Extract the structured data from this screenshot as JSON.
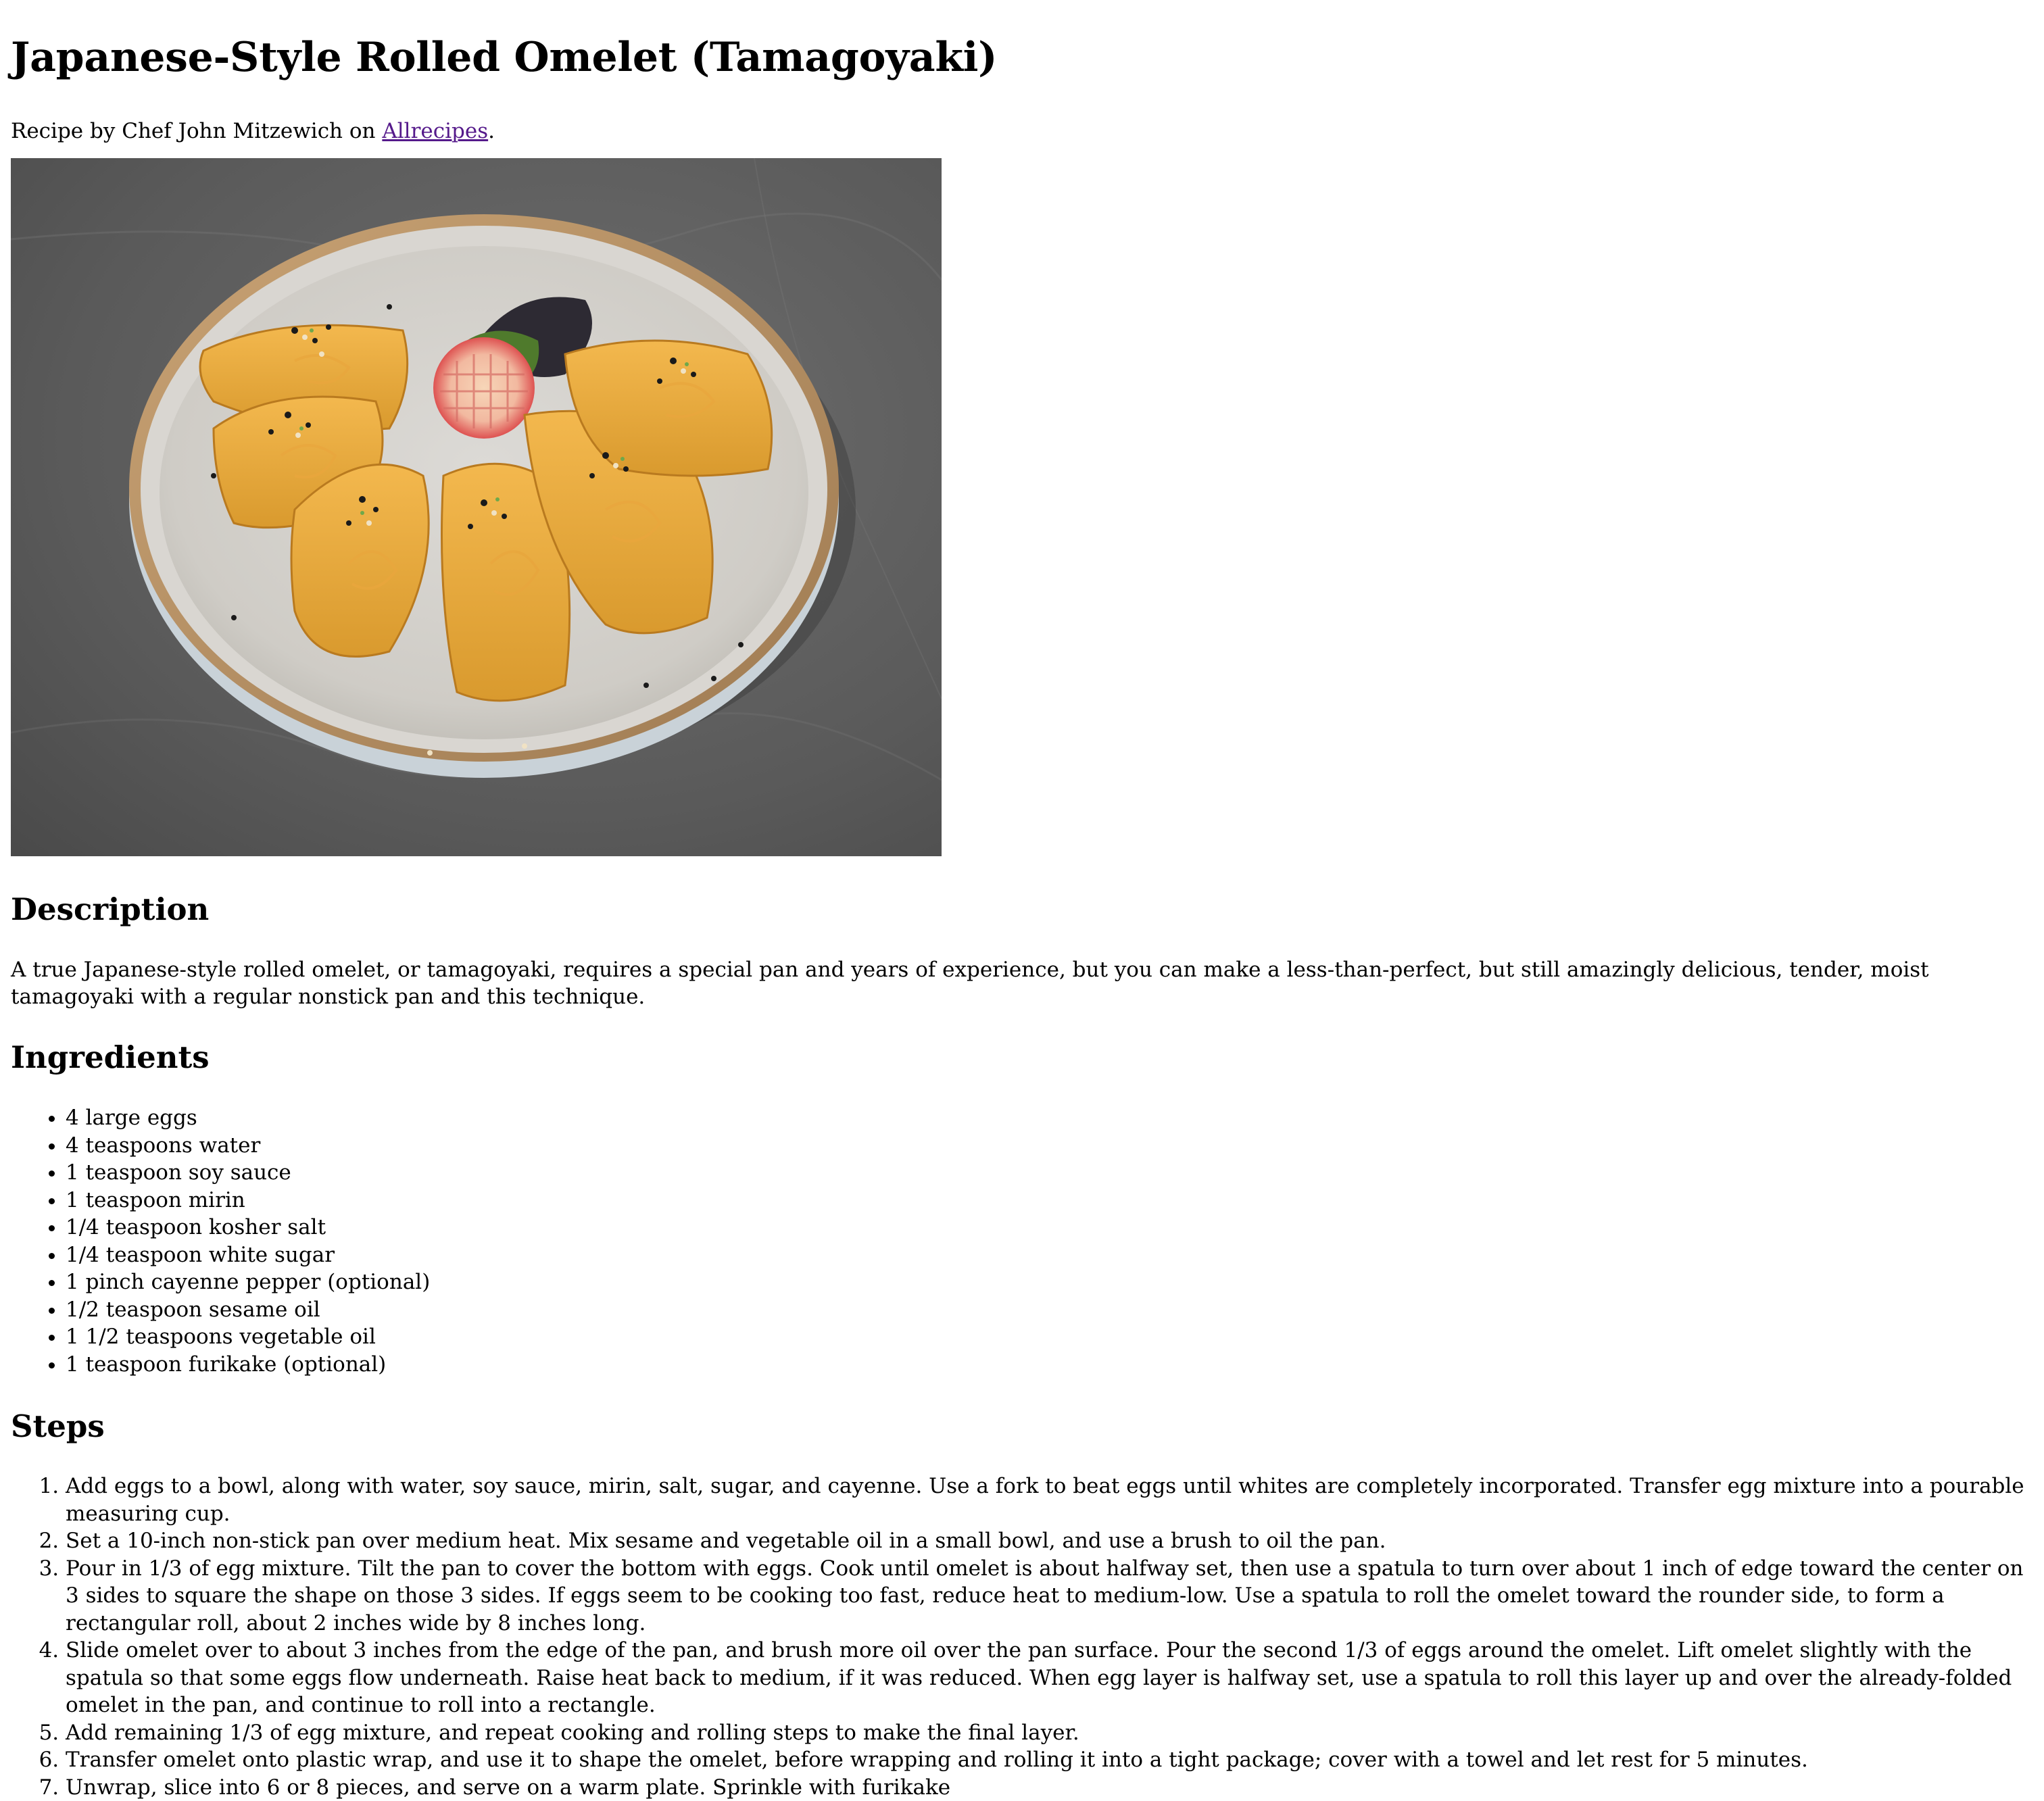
{
  "recipe": {
    "title": "Japanese-Style Rolled Omelet (Tamagoyaki)",
    "byline_prefix": "Recipe by Chef John Mitzewich on ",
    "source_link": "Allrecipes",
    "byline_suffix": "."
  },
  "image": {
    "description_icon": "photo-tamagoyaki-plate"
  },
  "description": {
    "heading": "Description",
    "text": "A true Japanese-style rolled omelet, or tamagoyaki, requires a special pan and years of experience, but you can make a less-than-perfect, but still amazingly delicious, tender, moist tamagoyaki with a regular nonstick pan and this technique."
  },
  "ingredients": {
    "heading": "Ingredients",
    "items": [
      "4 large eggs",
      "4 teaspoons water",
      "1 teaspoon soy sauce",
      "1 teaspoon mirin",
      "1/4 teaspoon kosher salt",
      "1/4 teaspoon white sugar",
      "1 pinch cayenne pepper (optional)",
      "1/2 teaspoon sesame oil",
      "1 1/2 teaspoons vegetable oil",
      "1 teaspoon furikake (optional)"
    ]
  },
  "steps": {
    "heading": "Steps",
    "items": [
      "Add eggs to a bowl, along with water, soy sauce, mirin, salt, sugar, and cayenne. Use a fork to beat eggs until whites are completely incorporated. Transfer egg mixture into a pourable measuring cup.",
      "Set a 10-inch non-stick pan over medium heat. Mix sesame and vegetable oil in a small bowl, and use a brush to oil the pan.",
      "Pour in 1/3 of egg mixture. Tilt the pan to cover the bottom with eggs. Cook until omelet is about halfway set, then use a spatula to turn over about 1 inch of edge toward the center on 3 sides to square the shape on those 3 sides. If eggs seem to be cooking too fast, reduce heat to medium-low. Use a spatula to roll the omelet toward the rounder side, to form a rectangular roll, about 2 inches wide by 8 inches long.",
      "Slide omelet over to about 3 inches from the edge of the pan, and brush more oil over the pan surface. Pour the second 1/3 of eggs around the omelet. Lift omelet slightly with the spatula so that some eggs flow underneath. Raise heat back to medium, if it was reduced. When egg layer is halfway set, use a spatula to roll this layer up and over the already-folded omelet in the pan, and continue to roll into a rectangle.",
      "Add remaining 1/3 of egg mixture, and repeat cooking and rolling steps to make the final layer.",
      "Transfer omelet onto plastic wrap, and use it to shape the omelet, before wrapping and rolling it into a tight package; cover with a towel and let rest for 5 minutes.",
      "Unwrap, slice into 6 or 8 pieces, and serve on a warm plate. Sprinkle with furikake"
    ]
  },
  "colors": {
    "link": "#551a8b",
    "background": "#ffffff",
    "text": "#000000"
  }
}
